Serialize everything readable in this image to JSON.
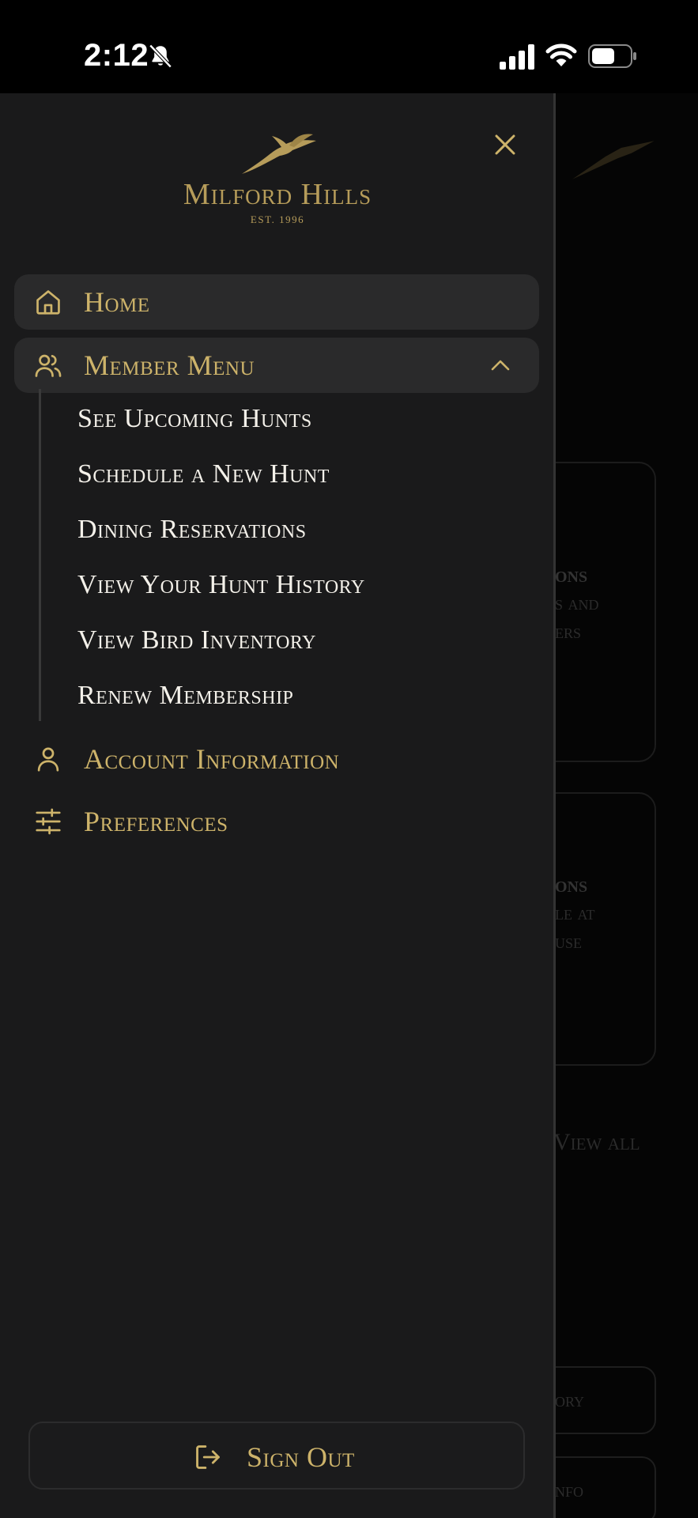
{
  "status_bar": {
    "time": "2:12"
  },
  "brand": {
    "name": "Milford Hills",
    "established": "EST. 1996",
    "accent_color": "#b69c5a"
  },
  "drawer": {
    "close_icon": "close-icon",
    "items": [
      {
        "label": "Home",
        "icon": "home-icon"
      },
      {
        "label": "Member Menu",
        "icon": "users-icon"
      },
      {
        "label": "Account Information",
        "icon": "user-icon"
      },
      {
        "label": "Preferences",
        "icon": "sliders-icon"
      }
    ],
    "member_menu_items": [
      "See Upcoming Hunts",
      "Schedule a New Hunt",
      "Dining Reservations",
      "View Your Hunt History",
      "View Bird Inventory",
      "Renew Membership"
    ],
    "sign_out": {
      "label": "Sign Out",
      "icon": "sign-out-icon"
    }
  },
  "background_page": {
    "card1_title": "ons",
    "card1_line1": "s and",
    "card1_line2": "ers",
    "card2_title": "ons",
    "card2_line1": "le at",
    "card2_line2": "use",
    "view_all": "View all",
    "button1": "ory",
    "button2": "nfo"
  }
}
